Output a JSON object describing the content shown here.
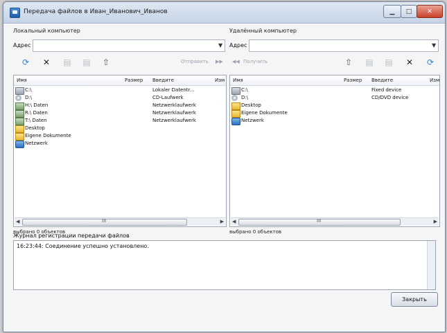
{
  "window": {
    "title": "Передача файлов в Иван_Иванович_Иванов"
  },
  "local": {
    "label": "Локальный компьютер",
    "address_label": "Адрес",
    "send_label": "Отправить",
    "columns": [
      "Имя",
      "Размер",
      "Введите",
      "Изм"
    ],
    "items": [
      {
        "name": "C:\\",
        "type": "Lokaler Datentr...",
        "icon": "drive-icon"
      },
      {
        "name": "D:\\",
        "type": "CD-Laufwerk",
        "icon": "cd-drive-icon"
      },
      {
        "name": "H:\\ Daten",
        "type": "Netzwerklaufwerk",
        "icon": "network-drive-icon"
      },
      {
        "name": "R:\\ Daten",
        "type": "Netzwerklaufwerk",
        "icon": "network-drive-icon"
      },
      {
        "name": "T:\\ Daten",
        "type": "Netzwerklaufwerk",
        "icon": "network-drive-icon"
      },
      {
        "name": "Desktop",
        "type": "",
        "icon": "folder-icon"
      },
      {
        "name": "Eigene Dokumente",
        "type": "",
        "icon": "folder-icon"
      },
      {
        "name": "Netzwerk",
        "type": "",
        "icon": "network-icon"
      }
    ],
    "status": "выбрано 0 объектов",
    "scroll_grip": "III"
  },
  "remote": {
    "label": "Удалённый компьютер",
    "address_label": "Адрес",
    "receive_label": "Получить",
    "columns": [
      "Имя",
      "Размер",
      "Введите",
      "Изм"
    ],
    "items": [
      {
        "name": "C:\\",
        "type": "Fixed device",
        "icon": "drive-icon"
      },
      {
        "name": "D:\\",
        "type": "CD/DVD device",
        "icon": "cd-drive-icon"
      },
      {
        "name": "Desktop",
        "type": "",
        "icon": "folder-icon"
      },
      {
        "name": "Eigene Dokumente",
        "type": "",
        "icon": "folder-icon"
      },
      {
        "name": "Netzwerk",
        "type": "",
        "icon": "network-icon"
      }
    ],
    "status": "выбрано 0 объектов",
    "scroll_grip": "III"
  },
  "log": {
    "label": "Журнал регистрации передачи файлов",
    "lines": [
      "16:23:44: Соединение успешно установлено."
    ]
  },
  "close_button": "Закрыть"
}
